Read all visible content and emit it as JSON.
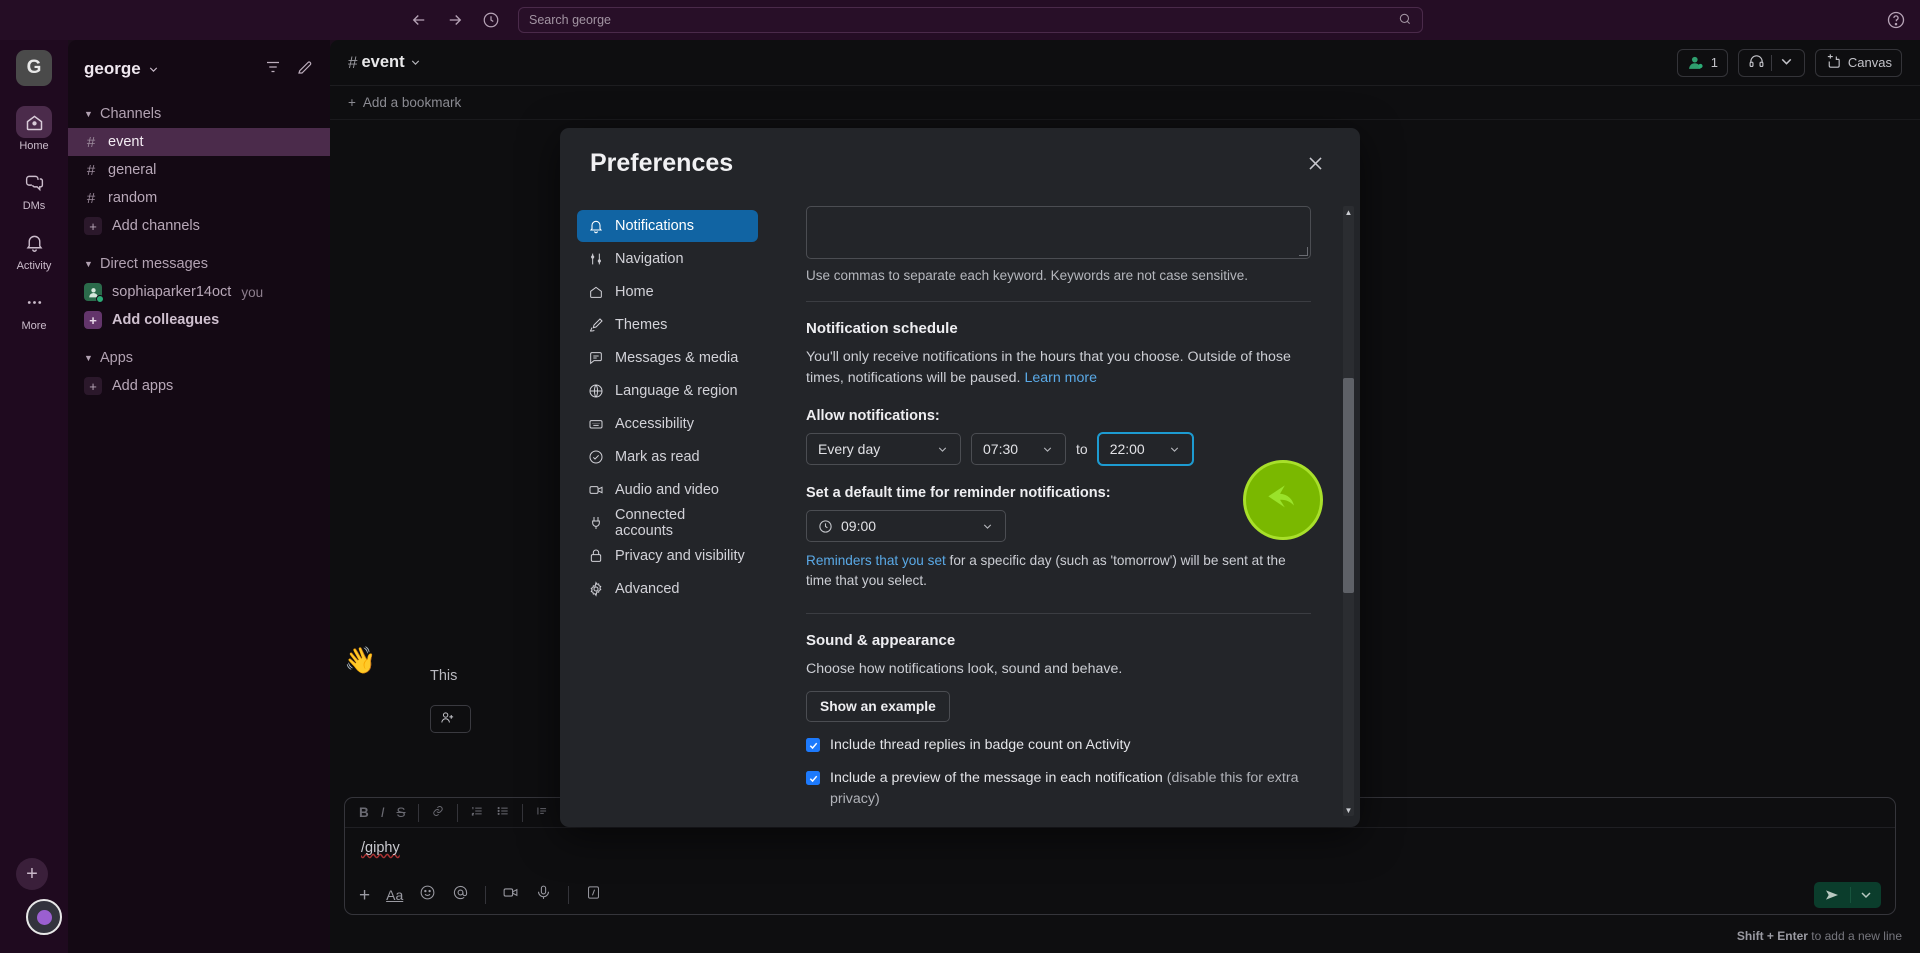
{
  "topbar": {
    "back_icon": "arrow-left-icon",
    "forward_icon": "arrow-right-icon",
    "history_icon": "clock-icon",
    "search_placeholder": "Search george",
    "search_value": "",
    "help_icon": "help-circle-icon"
  },
  "rail": {
    "workspace_initial": "G",
    "items": [
      {
        "label": "Home",
        "icon": "home-icon",
        "active": true
      },
      {
        "label": "DMs",
        "icon": "chat-bubble-icon",
        "active": false
      },
      {
        "label": "Activity",
        "icon": "bell-icon",
        "active": false
      },
      {
        "label": "More",
        "icon": "ellipsis-icon",
        "active": false
      }
    ]
  },
  "sidebar": {
    "workspace_name": "george",
    "sections": [
      {
        "title": "Channels",
        "items": [
          {
            "label": "event",
            "type": "channel",
            "active": true
          },
          {
            "label": "general",
            "type": "channel",
            "active": false
          },
          {
            "label": "random",
            "type": "channel",
            "active": false
          },
          {
            "label": "Add channels",
            "type": "add",
            "active": false
          }
        ]
      },
      {
        "title": "Direct messages",
        "items": [
          {
            "label": "sophiaparker14oct",
            "suffix": "you",
            "type": "dm",
            "active": false
          },
          {
            "label": "Add colleagues",
            "type": "add-accent",
            "active": false
          }
        ]
      },
      {
        "title": "Apps",
        "items": [
          {
            "label": "Add apps",
            "type": "add-plain",
            "active": false
          }
        ]
      }
    ]
  },
  "channel": {
    "hash": "#",
    "name": "event",
    "bookmark_label": "Add a bookmark",
    "members_count": "1",
    "canvas_label": "Canvas",
    "welcome_emoji": "👋",
    "welcome_text": "This",
    "invite_label": ""
  },
  "composer": {
    "value": "/giphy",
    "toolbar": [
      "B",
      "I",
      "S",
      "link",
      "ol",
      "ul",
      "quote",
      "code",
      "codeblock"
    ],
    "hint_bold": "Shift + Enter",
    "hint_rest": " to add a new line"
  },
  "modal": {
    "title": "Preferences",
    "close_icon": "close-icon",
    "nav": [
      {
        "label": "Notifications",
        "icon": "bell-icon",
        "active": true
      },
      {
        "label": "Navigation",
        "icon": "sliders-icon",
        "active": false
      },
      {
        "label": "Home",
        "icon": "home-icon",
        "active": false
      },
      {
        "label": "Themes",
        "icon": "brush-icon",
        "active": false
      },
      {
        "label": "Messages & media",
        "icon": "message-icon",
        "active": false
      },
      {
        "label": "Language & region",
        "icon": "globe-icon",
        "active": false
      },
      {
        "label": "Accessibility",
        "icon": "accessibility-icon",
        "active": false
      },
      {
        "label": "Mark as read",
        "icon": "check-circle-icon",
        "active": false
      },
      {
        "label": "Audio and video",
        "icon": "video-icon",
        "active": false
      },
      {
        "label": "Connected accounts",
        "icon": "plug-icon",
        "active": false
      },
      {
        "label": "Privacy and visibility",
        "icon": "lock-icon",
        "active": false
      },
      {
        "label": "Advanced",
        "icon": "gear-icon",
        "active": false
      }
    ],
    "keywords": {
      "value": "",
      "hint": "Use commas to separate each keyword. Keywords are not case sensitive."
    },
    "schedule": {
      "heading": "Notification schedule",
      "description": "You'll only receive notifications in the hours that you choose. Outside of those times, notifications will be paused. ",
      "learn_more": "Learn more",
      "allow_label": "Allow notifications:",
      "day_value": "Every day",
      "from_value": "07:30",
      "to_word": "to",
      "to_value": "22:00",
      "reminder_label": "Set a default time for reminder notifications:",
      "reminder_value": "09:00",
      "reminder_note_link": "Reminders that you set",
      "reminder_note_rest": " for a specific day (such as 'tomorrow') will be sent at the time that you select."
    },
    "sound": {
      "heading": "Sound & appearance",
      "description": "Choose how notifications look, sound and behave.",
      "example_button": "Show an example",
      "checkboxes": [
        {
          "label": "Include thread replies in badge count on Activity",
          "muted": "",
          "checked": true
        },
        {
          "label": "Include a preview of the message in each notification",
          "muted": " (disable this for extra privacy)",
          "checked": true
        }
      ]
    }
  },
  "cursor": {
    "icon": "cursor-arrow-icon",
    "accent": "#7ab800"
  }
}
